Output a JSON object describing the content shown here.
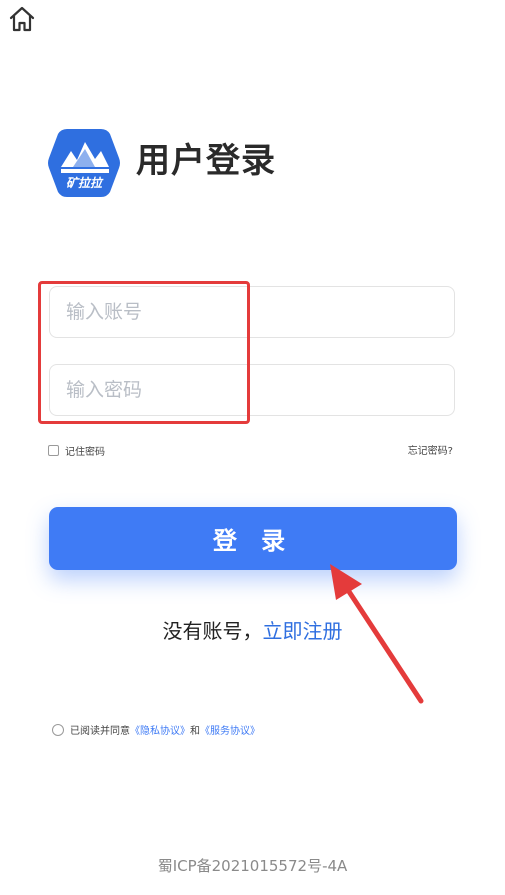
{
  "header": {
    "home_icon": "home-icon"
  },
  "brand": {
    "logo_text": "矿拉拉",
    "title": "用户登录",
    "color": "#2f6fe0"
  },
  "form": {
    "account_placeholder": "输入账号",
    "account_value": "",
    "password_placeholder": "输入密码",
    "password_value": "",
    "remember_label": "记住密码",
    "forgot_label": "忘记密码?"
  },
  "actions": {
    "login_label": "登 录",
    "accent": "#3f7bf5"
  },
  "register": {
    "prompt": "没有账号，",
    "link": "立即注册"
  },
  "agreement": {
    "prefix": "已阅读并同意",
    "privacy_link": "《隐私协议》",
    "joiner": "和",
    "service_link": "《服务协议》"
  },
  "footer": {
    "icp": "蜀ICP备2021015572号-4A"
  }
}
